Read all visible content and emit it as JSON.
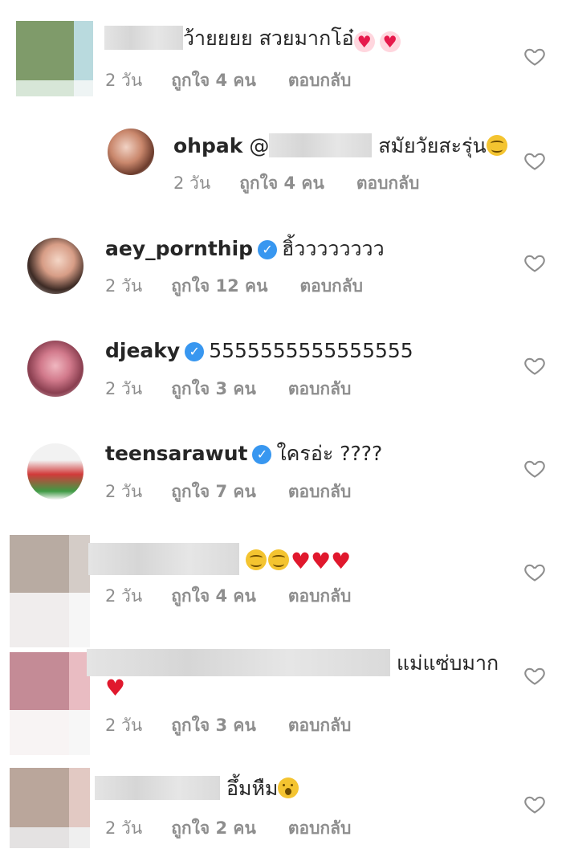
{
  "comments": [
    {
      "user": "",
      "text": "ว้ายยยย สวยมากโอ๋",
      "emoji": [
        "heart",
        "heart"
      ],
      "time": "2 วัน",
      "likes": "ถูกใจ 4 คน",
      "reply": "ตอบกลับ"
    },
    {
      "user": "ohpak",
      "mention": "@",
      "text": "สมัยวัยสะรุ่น",
      "time": "2 วัน",
      "likes": "ถูกใจ 4 คน",
      "reply": "ตอบกลับ"
    },
    {
      "user": "aey_pornthip",
      "verified": true,
      "text": "ฮิ้วววววววว",
      "time": "2 วัน",
      "likes": "ถูกใจ 12 คน",
      "reply": "ตอบกลับ"
    },
    {
      "user": "djeaky",
      "verified": true,
      "text": "5555555555555555",
      "time": "2 วัน",
      "likes": "ถูกใจ 3 คน",
      "reply": "ตอบกลับ"
    },
    {
      "user": "teensarawut",
      "verified": true,
      "text": "ใครอ่ะ ????",
      "time": "2 วัน",
      "likes": "ถูกใจ 7 คน",
      "reply": "ตอบกลับ"
    },
    {
      "user": "",
      "text": "",
      "emoji": [
        "smile",
        "smile",
        "heart",
        "heart",
        "heart"
      ],
      "time": "2 วัน",
      "likes": "ถูกใจ 4 คน",
      "reply": "ตอบกลับ"
    },
    {
      "user": "",
      "text": "แม่แซ่บมาก",
      "emoji": [
        "heart"
      ],
      "time": "2 วัน",
      "likes": "ถูกใจ 3 คน",
      "reply": "ตอบกลับ"
    },
    {
      "user": "",
      "text": "อึ้มหืม",
      "emoji": [
        "surprised"
      ],
      "time": "2 วัน",
      "likes": "ถูกใจ 2 คน",
      "reply": "ตอบกลับ"
    }
  ],
  "colors": {
    "verified": "#3897f0",
    "meta": "#8e8e8e",
    "heart_red": "#e0182d"
  },
  "icons": {
    "like": "heart-outline-icon",
    "verified": "verified-badge-icon"
  }
}
